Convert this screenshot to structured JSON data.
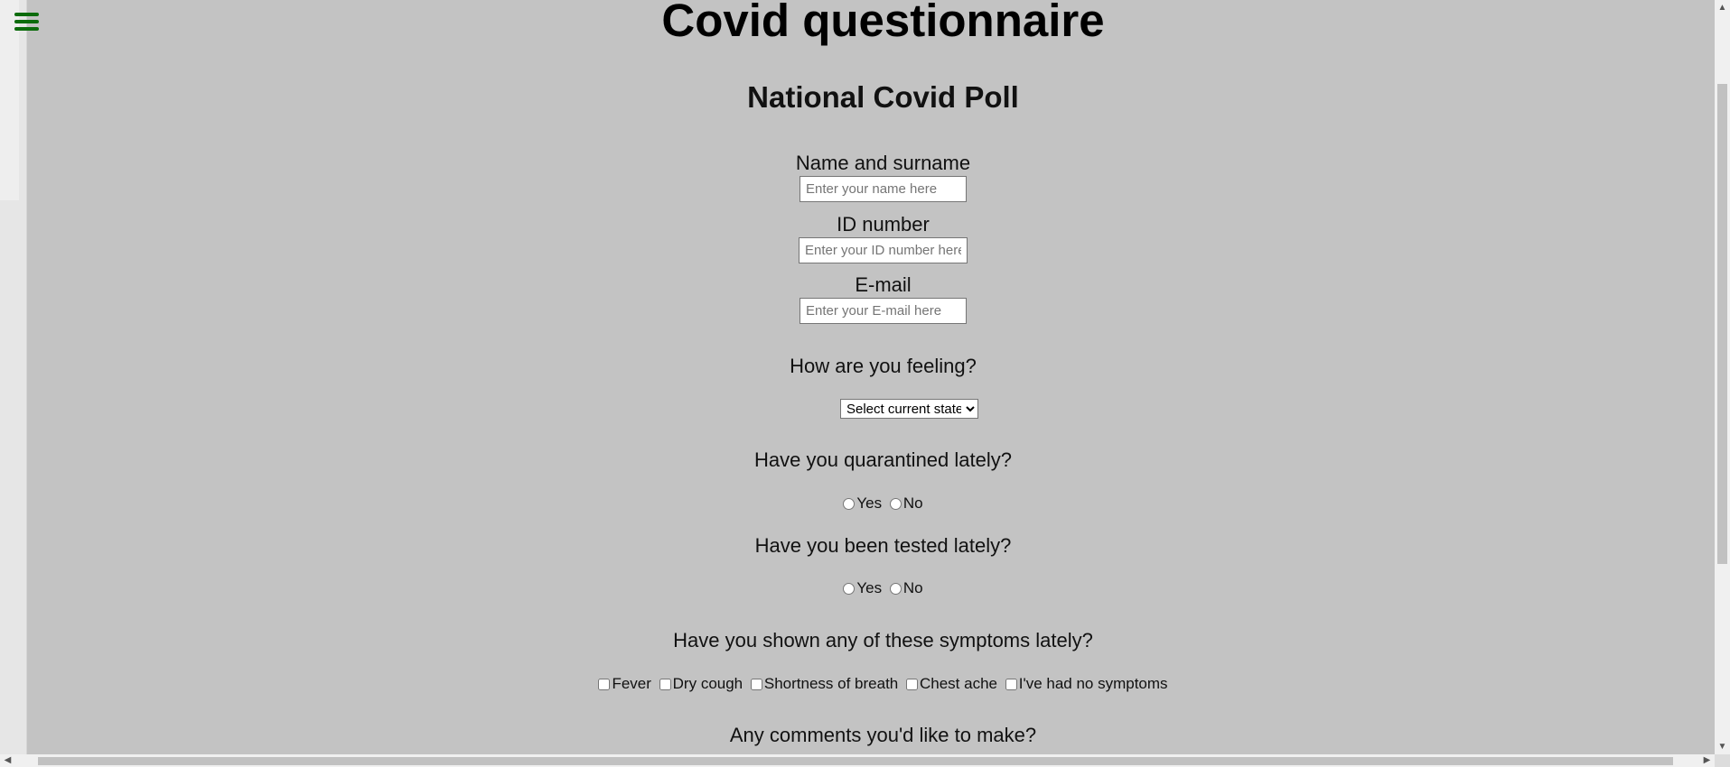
{
  "page": {
    "title": "Covid questionnaire",
    "subtitle": "National Covid Poll"
  },
  "form": {
    "name": {
      "label": "Name and surname",
      "placeholder": "Enter your name here",
      "value": ""
    },
    "id_number": {
      "label": "ID number",
      "placeholder": "Enter your ID number here",
      "value": ""
    },
    "email": {
      "label": "E-mail",
      "placeholder": "Enter your E-mail here",
      "value": ""
    },
    "feeling": {
      "question": "How are you feeling?",
      "selected": "Select current state",
      "options": [
        "Select current state"
      ]
    },
    "quarantine": {
      "question": "Have you quarantined lately?",
      "options": [
        "Yes",
        "No"
      ]
    },
    "tested": {
      "question": "Have you been tested lately?",
      "options": [
        "Yes",
        "No"
      ]
    },
    "symptoms": {
      "question": "Have you shown any of these symptoms lately?",
      "options": [
        "Fever",
        "Dry cough",
        "Shortness of breath",
        "Chest ache",
        "I've had no symptoms"
      ]
    },
    "comments": {
      "question": "Any comments you'd like to make?"
    }
  },
  "icons": {
    "menu": "hamburger-menu-icon"
  },
  "colors": {
    "background": "#c3c3c3",
    "menu_icon": "#0c6b0c"
  }
}
